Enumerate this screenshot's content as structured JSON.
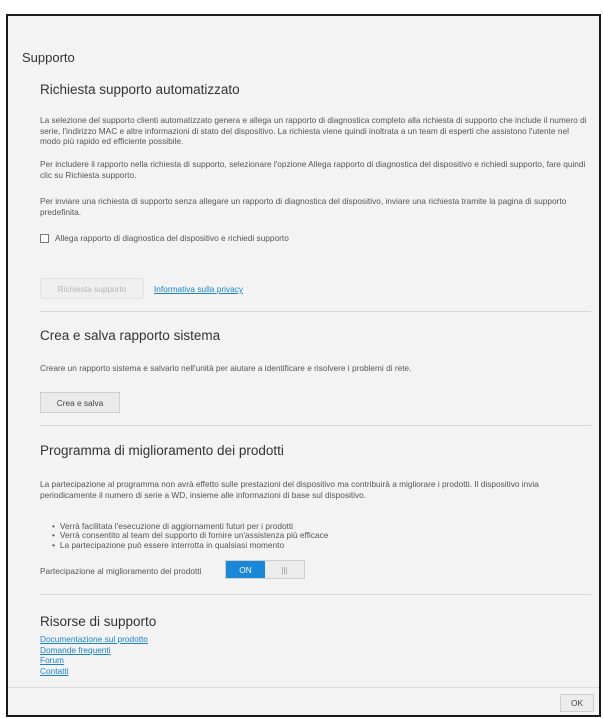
{
  "dialog": {
    "title": "Supporto"
  },
  "automated_support": {
    "heading": "Richiesta supporto automatizzato",
    "p1": "La selezione del supporto clienti automatizzato genera e allega un rapporto di diagnostica completo alla richiesta di supporto che include il numero di serie, l'indirizzo MAC e altre informazioni di stato del dispositivo. La richiesta viene quindi inoltrata a un team di esperti che assistono l'utente nel modo più rapido ed efficiente possibile.",
    "p2": "Per includere il rapporto nella richiesta di supporto, selezionare l'opzione Allega rapporto di diagnostica del dispositivo e richiedi supporto, fare quindi clic su Richiesta supporto.",
    "p3": "Per inviare una richiesta di supporto senza allegare un rapporto di diagnostica del dispositivo, inviare una richiesta tramite la pagina di supporto predefinita.",
    "checkbox_label": "Allega rapporto di diagnostica del dispositivo e richiedi supporto",
    "checkbox_checked": false,
    "request_button": "Richiesta supporto",
    "privacy_link": "Informativa sulla privacy"
  },
  "system_report": {
    "heading": "Crea e salva rapporto sistema",
    "description": "Creare un rapporto sistema e salvarlo nell'unità per aiutare a identificare e risolvere i problemi di rete.",
    "button": "Crea e salva"
  },
  "improvement": {
    "heading": "Programma di miglioramento dei prodotti",
    "description": "La partecipazione al programma non avrà effetto sulle prestazioni del dispositivo ma contribuirà a migliorare i prodotti. Il dispositivo invia periodicamente il numero di serie a WD, insieme alle informazioni di base sul dispositivo.",
    "bullets": [
      "Verrà facilitata l'esecuzione di aggiornamenti futuri per i prodotti",
      "Verrà consentito al team del supporto di fornire un'assistenza più efficace",
      "La partecipazione può essere interrotta in qualsiasi momento"
    ],
    "toggle_label": "Partecipazione al miglioramento dei prodotti",
    "toggle_on": "ON",
    "toggle_off": "|||"
  },
  "resources": {
    "heading": "Risorse di supporto",
    "links": [
      "Documentazione sul prodotto",
      "Domande frequenti",
      "Forum",
      "Contatti"
    ]
  },
  "footer": {
    "ok_button": "OK"
  },
  "colors": {
    "accent": "#1a87d7",
    "link": "#1a83c9",
    "panel": "#f3f3f3"
  }
}
